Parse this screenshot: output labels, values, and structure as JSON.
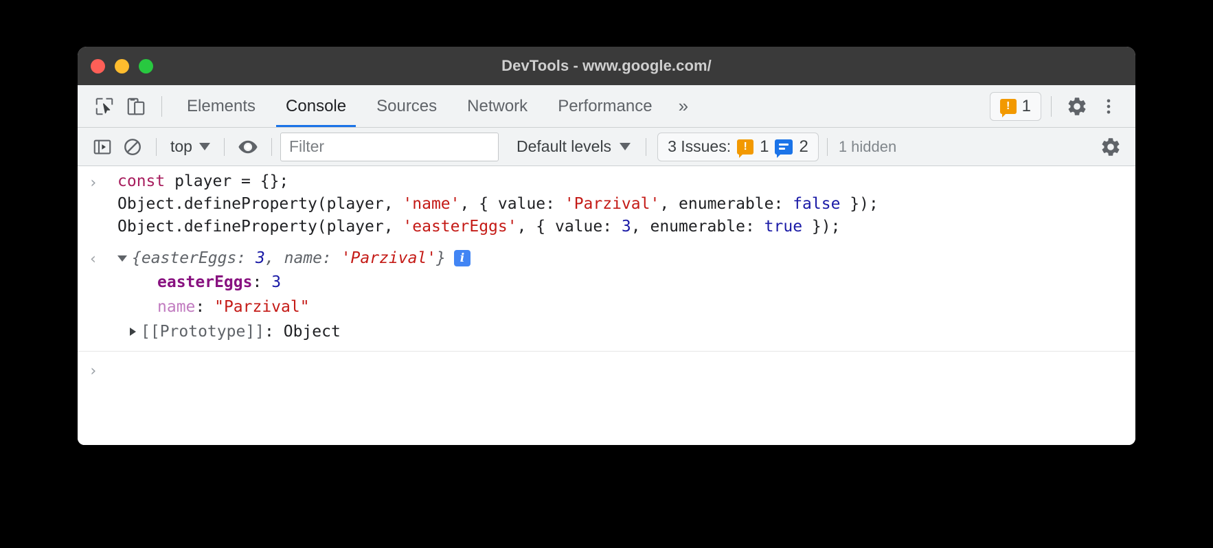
{
  "window": {
    "title": "DevTools - www.google.com/",
    "traffic_lights": [
      {
        "name": "close",
        "color": "#ff5f57"
      },
      {
        "name": "minimize",
        "color": "#febc2e"
      },
      {
        "name": "zoom",
        "color": "#28c840"
      }
    ]
  },
  "tabbar": {
    "inspect_icon": "inspect-element-icon",
    "device_icon": "device-toolbar-icon",
    "tabs": [
      {
        "label": "Elements",
        "active": false
      },
      {
        "label": "Console",
        "active": true
      },
      {
        "label": "Sources",
        "active": false
      },
      {
        "label": "Network",
        "active": false
      },
      {
        "label": "Performance",
        "active": false
      }
    ],
    "overflow_label": "»",
    "issues_badge": {
      "warning_count": "1"
    },
    "settings_icon": "gear-icon",
    "more_icon": "kebab-menu-icon"
  },
  "console_toolbar": {
    "sidebar_toggle_icon": "console-sidebar-icon",
    "clear_icon": "clear-console-icon",
    "context_label": "top",
    "eye_icon": "live-expression-icon",
    "filter_placeholder": "Filter",
    "filter_value": "",
    "levels_label": "Default levels",
    "issues_label": "3 Issues:",
    "issues_warning_count": "1",
    "issues_info_count": "2",
    "hidden_label": "1 hidden",
    "settings_icon": "console-settings-gear-icon"
  },
  "console": {
    "input_prompt": "›",
    "output_prompt": "‹",
    "next_prompt": "›",
    "code": {
      "line1": {
        "keyword": "const",
        "rest": " player = {};"
      },
      "line2": {
        "head": "Object.defineProperty(player, ",
        "str1": "'name'",
        "mid": ", { value: ",
        "str2": "'Parzival'",
        "mid2": ", enumerable: ",
        "bool": "false",
        "tail": " });"
      },
      "line3": {
        "head": "Object.defineProperty(player, ",
        "str1": "'easterEggs'",
        "mid": ", { value: ",
        "num": "3",
        "mid2": ", enumerable: ",
        "bool": "true",
        "tail": " });"
      }
    },
    "result": {
      "open_brace": "{",
      "key1": "easterEggs: ",
      "val1": "3",
      "sep": ", ",
      "key2": "name: ",
      "val2": "'Parzival'",
      "close_brace": "}",
      "info_chip": "i"
    },
    "properties": [
      {
        "key": "easterEggs",
        "colon": ": ",
        "value": "3",
        "value_type": "number",
        "enumerable": true
      },
      {
        "key": "name",
        "colon": ": ",
        "value": "\"Parzival\"",
        "value_type": "string",
        "enumerable": false
      }
    ],
    "prototype_row": {
      "key": "[[Prototype]]",
      "colon": ": ",
      "value": "Object"
    }
  },
  "colors": {
    "accent_blue": "#1a73e8",
    "warning_orange": "#f29900",
    "info_blue": "#1a73e8",
    "string_red": "#c41a16",
    "number_blue": "#1a1aa6",
    "keyword_magenta": "#a71d5d",
    "property_purple": "#881280",
    "titlebar_gray": "#3a3a3a",
    "toolbar_gray": "#f1f3f4"
  }
}
